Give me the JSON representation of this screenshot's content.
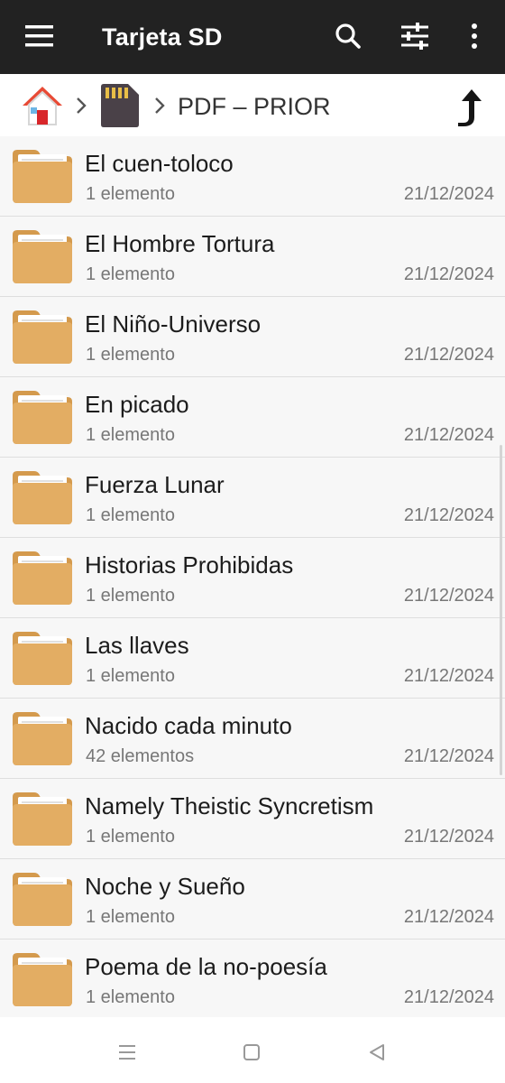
{
  "app_bar": {
    "title": "Tarjeta SD",
    "menu_icon": "hamburger-menu-icon",
    "search_icon": "search-icon",
    "filter_icon": "sliders-icon",
    "more_icon": "more-vertical-icon"
  },
  "breadcrumb": {
    "home_icon": "home-icon",
    "storage_icon": "sd-card-icon",
    "current_folder": "PDF – PRIOR",
    "up_icon": "arrow-up-icon"
  },
  "folders": [
    {
      "name": "El cuen-toloco",
      "count": "1 elemento",
      "date": "21/12/2024"
    },
    {
      "name": "El Hombre Tortura",
      "count": "1 elemento",
      "date": "21/12/2024"
    },
    {
      "name": "El Niño-Universo",
      "count": "1 elemento",
      "date": "21/12/2024"
    },
    {
      "name": "En picado",
      "count": "1 elemento",
      "date": "21/12/2024"
    },
    {
      "name": "Fuerza Lunar",
      "count": "1 elemento",
      "date": "21/12/2024"
    },
    {
      "name": "Historias Prohibidas",
      "count": "1 elemento",
      "date": "21/12/2024"
    },
    {
      "name": "Las llaves",
      "count": "1 elemento",
      "date": "21/12/2024"
    },
    {
      "name": "Nacido cada minuto",
      "count": "42 elementos",
      "date": "21/12/2024"
    },
    {
      "name": "Namely Theistic Syncretism",
      "count": "1 elemento",
      "date": "21/12/2024"
    },
    {
      "name": "Noche y Sueño",
      "count": "1 elemento",
      "date": "21/12/2024"
    },
    {
      "name": "Poema de la no-poesía",
      "count": "1 elemento",
      "date": "21/12/2024"
    }
  ],
  "system_nav": {
    "menu_icon": "recent-apps-icon",
    "home_icon": "nav-home-icon",
    "back_icon": "nav-back-icon"
  },
  "colors": {
    "app_bar": "#222222",
    "folder": "#e3ad63",
    "folder_edge": "#d49a4d",
    "home_roof": "#e84a35",
    "home_door": "#d8262a",
    "sd_card": "#4a4148",
    "sd_contact": "#e8bd47"
  }
}
